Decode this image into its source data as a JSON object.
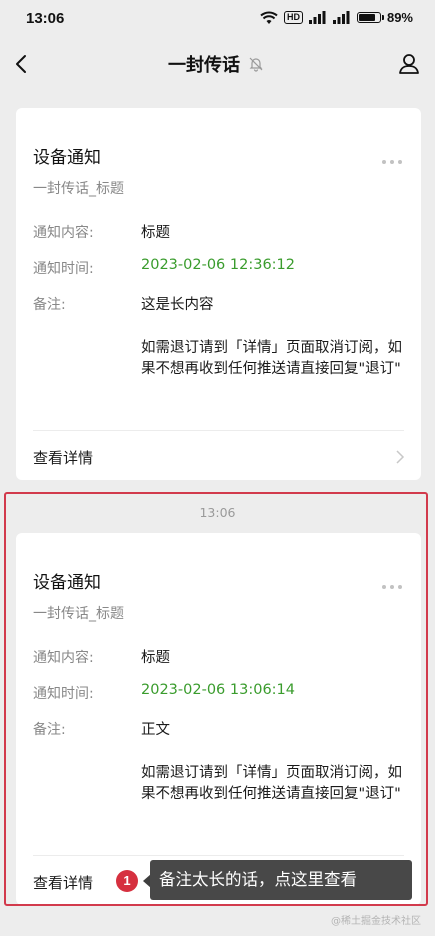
{
  "status_bar": {
    "time": "13:06",
    "hd_label": "HD",
    "battery_percent": "89%",
    "battery_level": 0.89
  },
  "nav": {
    "title": "一封传话"
  },
  "cards": [
    {
      "title": "设备通知",
      "subtitle": "一封传话_标题",
      "content_label": "通知内容:",
      "content_value": "标题",
      "time_label": "通知时间:",
      "time_value": "2023-02-06 12:36:12",
      "note_label": "备注:",
      "note_value": "这是长内容",
      "long_text": "如需退订请到「详情」页面取消订阅，如果不想再收到任何推送请直接回复\"退订\"",
      "detail_label": "查看详情"
    },
    {
      "title": "设备通知",
      "subtitle": "一封传话_标题",
      "content_label": "通知内容:",
      "content_value": "标题",
      "time_label": "通知时间:",
      "time_value": "2023-02-06 13:06:14",
      "note_label": "备注:",
      "note_value": "正文",
      "long_text": "如需退订请到「详情」页面取消订阅，如果不想再收到任何推送请直接回复\"退订\"",
      "detail_label": "查看详情"
    }
  ],
  "timestamp": "13:06",
  "tooltip": {
    "badge": "1",
    "text": "备注太长的话，点这里查看"
  },
  "watermark": "@稀土掘金技术社区",
  "colors": {
    "accent_green": "#3a9c2d",
    "highlight_red": "#d23a4c"
  }
}
